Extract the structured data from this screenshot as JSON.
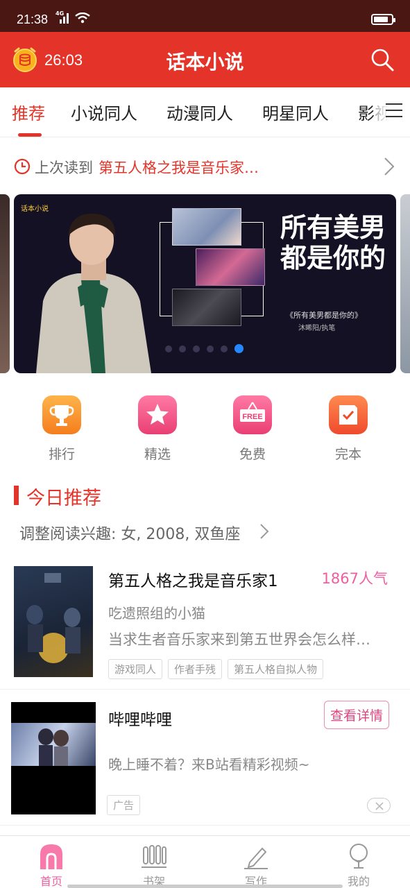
{
  "status": {
    "time": "21:38",
    "network": "4G",
    "battery_level": 0.85
  },
  "header": {
    "timer": "26:03",
    "title": "话本小说"
  },
  "tabs": [
    {
      "label": "推荐",
      "active": true
    },
    {
      "label": "小说同人",
      "active": false
    },
    {
      "label": "动漫同人",
      "active": false
    },
    {
      "label": "明星同人",
      "active": false
    },
    {
      "label": "影视",
      "active": false
    }
  ],
  "last_read": {
    "prefix": "上次读到",
    "title": "第五人格之我是音乐家…"
  },
  "banner": {
    "logo": "话本小说",
    "headline": "所有美男都是你的",
    "subtitle": "《所有美男都是你的》",
    "author": "沐晞阳/执笔",
    "dot_count": 6,
    "active_dot": 5
  },
  "quick_nav": [
    {
      "label": "排行",
      "icon": "trophy-icon",
      "color": "#f7962b"
    },
    {
      "label": "精选",
      "icon": "star-icon",
      "color": "#f0507f"
    },
    {
      "label": "免费",
      "icon": "free-icon",
      "color": "#f0507f"
    },
    {
      "label": "完本",
      "icon": "check-book-icon",
      "color": "#f55b3a"
    }
  ],
  "recommend": {
    "title": "今日推荐",
    "interest": "调整阅读兴趣: 女, 2008, 双鱼座"
  },
  "book": {
    "title": "第五人格之我是音乐家1",
    "popularity": "1867人气",
    "author": "吃遗照组的小猫",
    "description": "当求生者音乐家来到第五世界会怎么样…",
    "tags": [
      "游戏同人",
      "作者手残",
      "第五人格自拟人物"
    ]
  },
  "ad": {
    "title": "哔哩哔哩",
    "button": "查看详情",
    "description": "晚上睡不着？来B站看精彩视频~",
    "tag": "广告"
  },
  "bottom_nav": [
    {
      "label": "首页",
      "icon": "home-icon",
      "active": true
    },
    {
      "label": "书架",
      "icon": "bookshelf-icon",
      "active": false
    },
    {
      "label": "写作",
      "icon": "pen-icon",
      "active": false
    },
    {
      "label": "我的",
      "icon": "profile-icon",
      "active": false
    }
  ],
  "colors": {
    "brand": "#e4342a",
    "status_bar": "#4a1713",
    "accent_pink": "#ef5ea0"
  }
}
